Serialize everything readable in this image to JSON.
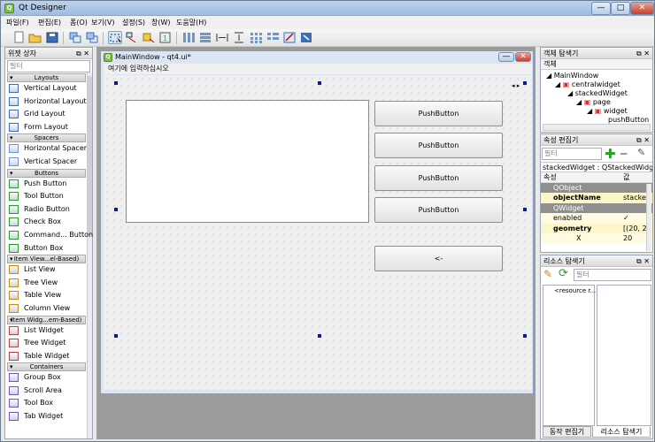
{
  "window": {
    "title": "Qt Designer",
    "min": "—",
    "max": "□",
    "close": "✕"
  },
  "menu": [
    "파일(F)",
    "편집(E)",
    "폼(O)",
    "보기(V)",
    "설정(S)",
    "창(W)",
    "도움말(H)"
  ],
  "widget_box": {
    "title": "위젯 상자",
    "filter_placeholder": "필터",
    "categories": [
      {
        "name": "Layouts",
        "items": [
          "Vertical Layout",
          "Horizontal Layout",
          "Grid Layout",
          "Form Layout"
        ]
      },
      {
        "name": "Spacers",
        "items": [
          "Horizontal Spacer",
          "Vertical Spacer"
        ]
      },
      {
        "name": "Buttons",
        "items": [
          "Push Button",
          "Tool Button",
          "Radio Button",
          "Check Box",
          "Command... Button",
          "Button Box"
        ]
      },
      {
        "name": "Item View...el-Based)",
        "items": [
          "List View",
          "Tree View",
          "Table View",
          "Column View"
        ]
      },
      {
        "name": "Item Widg...em-Based)",
        "items": [
          "List Widget",
          "Tree Widget",
          "Table Widget"
        ]
      },
      {
        "name": "Containers",
        "items": [
          "Group Box",
          "Scroll Area",
          "Tool Box",
          "Tab Widget"
        ]
      }
    ]
  },
  "form": {
    "title": "MainWindow - qt4.ui*",
    "menu_placeholder": "여기에 입력하십시오",
    "buttons": [
      "PushButton",
      "PushButton",
      "PushButton",
      "PushButton",
      "<-"
    ]
  },
  "object_inspector": {
    "title": "객체 탐색기",
    "header": "객체",
    "nodes": [
      "MainWindow",
      "centralwidget",
      "stackedWidget",
      "page",
      "widget",
      "pushButton"
    ]
  },
  "property_editor": {
    "title": "속성 편집기",
    "filter_placeholder": "필터",
    "object_label": "stackedWidget : QStackedWidget",
    "col_prop": "속성",
    "col_value": "값",
    "rows": [
      {
        "key": "QObject",
        "value": "",
        "type": "group"
      },
      {
        "key": "objectName",
        "value": "stacked",
        "type": "bold"
      },
      {
        "key": "QWidget",
        "value": "",
        "type": "group"
      },
      {
        "key": "enabled",
        "value": "✓",
        "type": "normal"
      },
      {
        "key": "geometry",
        "value": "[(20, 2",
        "type": "bold"
      },
      {
        "key": "X",
        "value": "20",
        "type": "normal"
      }
    ]
  },
  "resource_browser": {
    "title": "리소스 탐색기",
    "filter_placeholder": "필터",
    "root": "<resource r..."
  },
  "bottom_tabs": [
    "동작 편집기",
    "리소스 탐색기"
  ]
}
